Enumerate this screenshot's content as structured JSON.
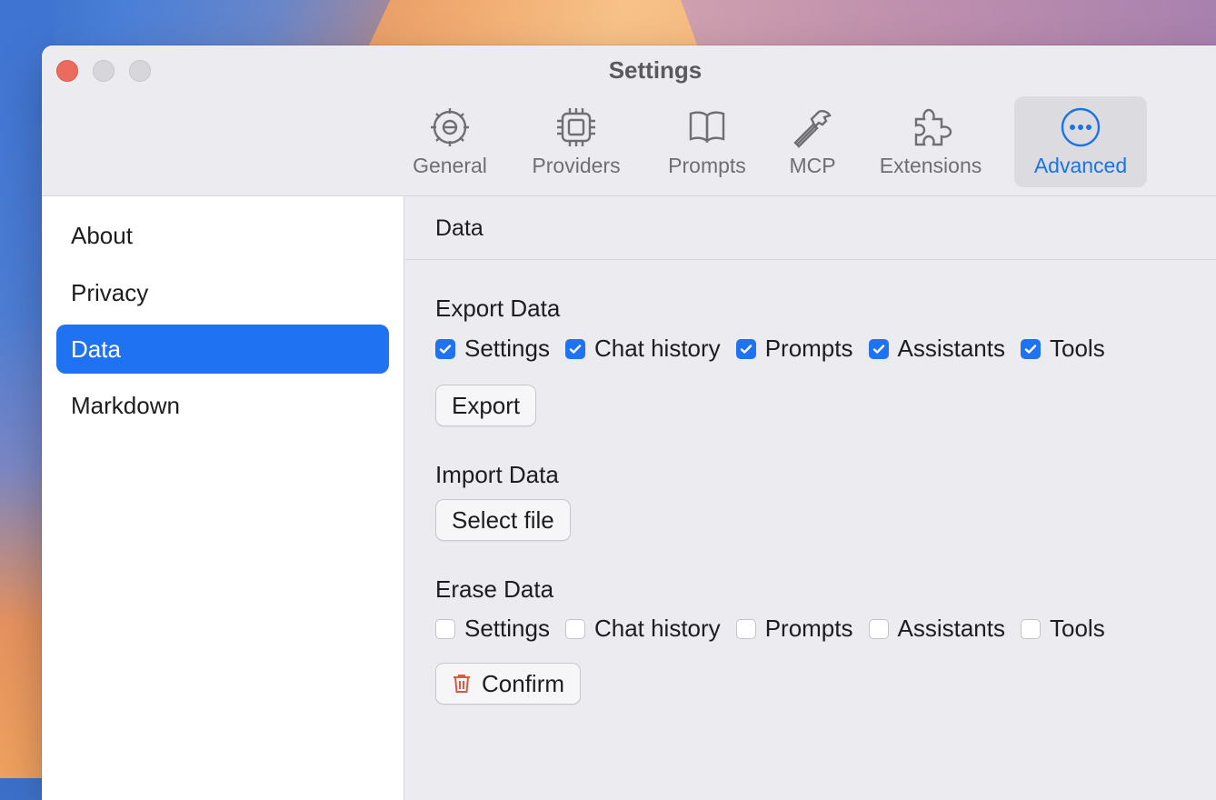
{
  "window": {
    "title": "Settings"
  },
  "toolbar": {
    "items": [
      {
        "label": "General",
        "icon": "gear-icon"
      },
      {
        "label": "Providers",
        "icon": "chip-icon"
      },
      {
        "label": "Prompts",
        "icon": "book-icon"
      },
      {
        "label": "MCP",
        "icon": "hammer-icon"
      },
      {
        "label": "Extensions",
        "icon": "puzzle-icon"
      },
      {
        "label": "Advanced",
        "icon": "ellipsis-circle-icon"
      }
    ],
    "active": "Advanced",
    "accent_color": "#1a73e8"
  },
  "sidebar": {
    "items": [
      {
        "label": "About"
      },
      {
        "label": "Privacy"
      },
      {
        "label": "Data"
      },
      {
        "label": "Markdown"
      }
    ],
    "active": "Data",
    "active_color": "#1f72f2"
  },
  "content": {
    "header": "Data",
    "export": {
      "title": "Export Data",
      "options": [
        {
          "label": "Settings",
          "checked": true
        },
        {
          "label": "Chat history",
          "checked": true
        },
        {
          "label": "Prompts",
          "checked": true
        },
        {
          "label": "Assistants",
          "checked": true
        },
        {
          "label": "Tools",
          "checked": true
        }
      ],
      "button": "Export"
    },
    "import": {
      "title": "Import Data",
      "button": "Select file"
    },
    "erase": {
      "title": "Erase Data",
      "options": [
        {
          "label": "Settings",
          "checked": false
        },
        {
          "label": "Chat history",
          "checked": false
        },
        {
          "label": "Prompts",
          "checked": false
        },
        {
          "label": "Assistants",
          "checked": false
        },
        {
          "label": "Tools",
          "checked": false
        }
      ],
      "button": "Confirm",
      "button_icon": "trash-icon",
      "danger_color": "#e2553f"
    }
  }
}
